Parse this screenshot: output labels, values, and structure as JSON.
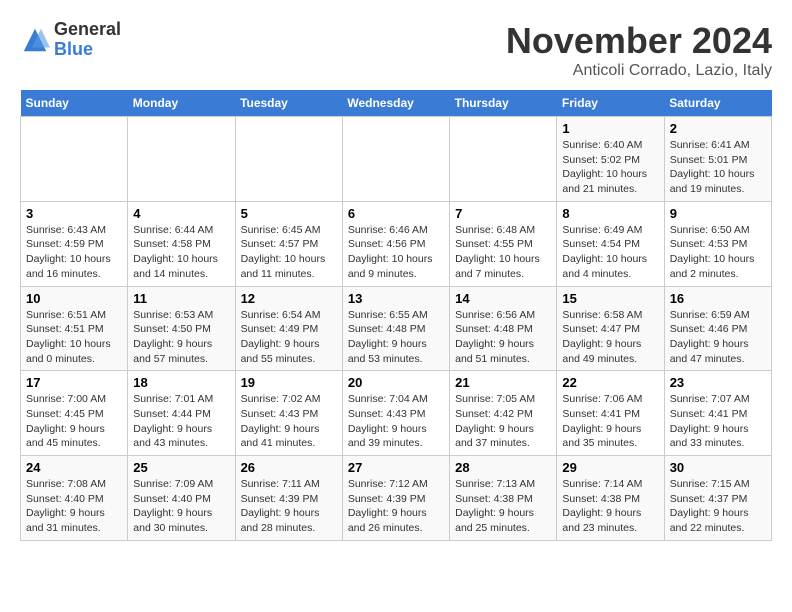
{
  "logo": {
    "general": "General",
    "blue": "Blue"
  },
  "title": "November 2024",
  "subtitle": "Anticoli Corrado, Lazio, Italy",
  "weekdays": [
    "Sunday",
    "Monday",
    "Tuesday",
    "Wednesday",
    "Thursday",
    "Friday",
    "Saturday"
  ],
  "weeks": [
    [
      {
        "day": "",
        "info": ""
      },
      {
        "day": "",
        "info": ""
      },
      {
        "day": "",
        "info": ""
      },
      {
        "day": "",
        "info": ""
      },
      {
        "day": "",
        "info": ""
      },
      {
        "day": "1",
        "info": "Sunrise: 6:40 AM\nSunset: 5:02 PM\nDaylight: 10 hours and 21 minutes."
      },
      {
        "day": "2",
        "info": "Sunrise: 6:41 AM\nSunset: 5:01 PM\nDaylight: 10 hours and 19 minutes."
      }
    ],
    [
      {
        "day": "3",
        "info": "Sunrise: 6:43 AM\nSunset: 4:59 PM\nDaylight: 10 hours and 16 minutes."
      },
      {
        "day": "4",
        "info": "Sunrise: 6:44 AM\nSunset: 4:58 PM\nDaylight: 10 hours and 14 minutes."
      },
      {
        "day": "5",
        "info": "Sunrise: 6:45 AM\nSunset: 4:57 PM\nDaylight: 10 hours and 11 minutes."
      },
      {
        "day": "6",
        "info": "Sunrise: 6:46 AM\nSunset: 4:56 PM\nDaylight: 10 hours and 9 minutes."
      },
      {
        "day": "7",
        "info": "Sunrise: 6:48 AM\nSunset: 4:55 PM\nDaylight: 10 hours and 7 minutes."
      },
      {
        "day": "8",
        "info": "Sunrise: 6:49 AM\nSunset: 4:54 PM\nDaylight: 10 hours and 4 minutes."
      },
      {
        "day": "9",
        "info": "Sunrise: 6:50 AM\nSunset: 4:53 PM\nDaylight: 10 hours and 2 minutes."
      }
    ],
    [
      {
        "day": "10",
        "info": "Sunrise: 6:51 AM\nSunset: 4:51 PM\nDaylight: 10 hours and 0 minutes."
      },
      {
        "day": "11",
        "info": "Sunrise: 6:53 AM\nSunset: 4:50 PM\nDaylight: 9 hours and 57 minutes."
      },
      {
        "day": "12",
        "info": "Sunrise: 6:54 AM\nSunset: 4:49 PM\nDaylight: 9 hours and 55 minutes."
      },
      {
        "day": "13",
        "info": "Sunrise: 6:55 AM\nSunset: 4:48 PM\nDaylight: 9 hours and 53 minutes."
      },
      {
        "day": "14",
        "info": "Sunrise: 6:56 AM\nSunset: 4:48 PM\nDaylight: 9 hours and 51 minutes."
      },
      {
        "day": "15",
        "info": "Sunrise: 6:58 AM\nSunset: 4:47 PM\nDaylight: 9 hours and 49 minutes."
      },
      {
        "day": "16",
        "info": "Sunrise: 6:59 AM\nSunset: 4:46 PM\nDaylight: 9 hours and 47 minutes."
      }
    ],
    [
      {
        "day": "17",
        "info": "Sunrise: 7:00 AM\nSunset: 4:45 PM\nDaylight: 9 hours and 45 minutes."
      },
      {
        "day": "18",
        "info": "Sunrise: 7:01 AM\nSunset: 4:44 PM\nDaylight: 9 hours and 43 minutes."
      },
      {
        "day": "19",
        "info": "Sunrise: 7:02 AM\nSunset: 4:43 PM\nDaylight: 9 hours and 41 minutes."
      },
      {
        "day": "20",
        "info": "Sunrise: 7:04 AM\nSunset: 4:43 PM\nDaylight: 9 hours and 39 minutes."
      },
      {
        "day": "21",
        "info": "Sunrise: 7:05 AM\nSunset: 4:42 PM\nDaylight: 9 hours and 37 minutes."
      },
      {
        "day": "22",
        "info": "Sunrise: 7:06 AM\nSunset: 4:41 PM\nDaylight: 9 hours and 35 minutes."
      },
      {
        "day": "23",
        "info": "Sunrise: 7:07 AM\nSunset: 4:41 PM\nDaylight: 9 hours and 33 minutes."
      }
    ],
    [
      {
        "day": "24",
        "info": "Sunrise: 7:08 AM\nSunset: 4:40 PM\nDaylight: 9 hours and 31 minutes."
      },
      {
        "day": "25",
        "info": "Sunrise: 7:09 AM\nSunset: 4:40 PM\nDaylight: 9 hours and 30 minutes."
      },
      {
        "day": "26",
        "info": "Sunrise: 7:11 AM\nSunset: 4:39 PM\nDaylight: 9 hours and 28 minutes."
      },
      {
        "day": "27",
        "info": "Sunrise: 7:12 AM\nSunset: 4:39 PM\nDaylight: 9 hours and 26 minutes."
      },
      {
        "day": "28",
        "info": "Sunrise: 7:13 AM\nSunset: 4:38 PM\nDaylight: 9 hours and 25 minutes."
      },
      {
        "day": "29",
        "info": "Sunrise: 7:14 AM\nSunset: 4:38 PM\nDaylight: 9 hours and 23 minutes."
      },
      {
        "day": "30",
        "info": "Sunrise: 7:15 AM\nSunset: 4:37 PM\nDaylight: 9 hours and 22 minutes."
      }
    ]
  ]
}
